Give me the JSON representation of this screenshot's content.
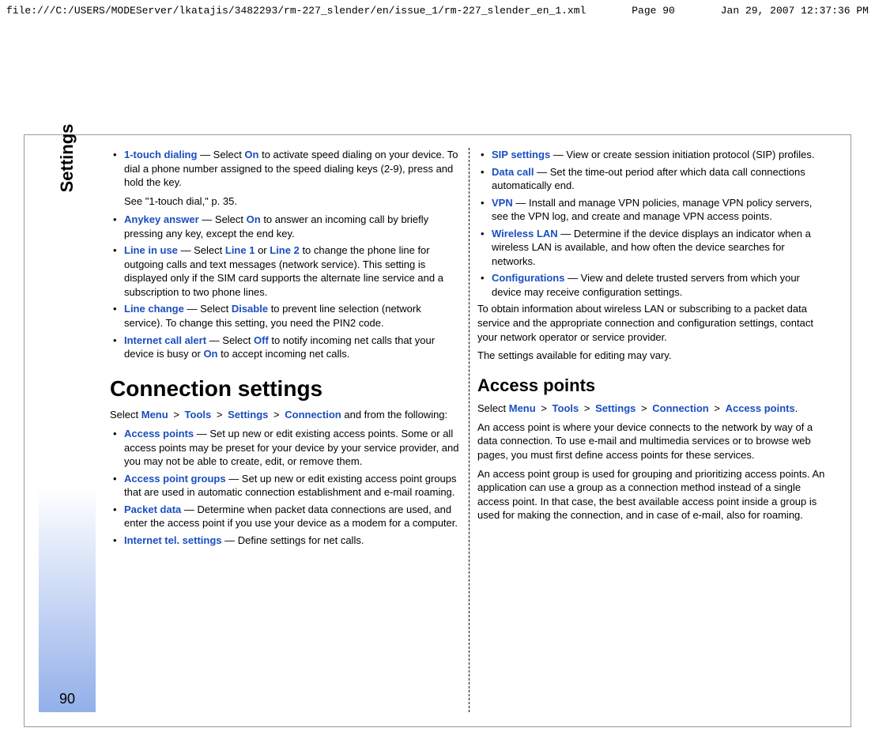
{
  "header": {
    "path": "file:///C:/USERS/MODEServer/lkatajis/3482293/rm-227_slender/en/issue_1/rm-227_slender_en_1.xml",
    "page_label": "Page 90",
    "timestamp": "Jan 29, 2007 12:37:36 PM"
  },
  "gutter": {
    "side_label": "Settings",
    "page_number": "90"
  },
  "left": {
    "items": [
      {
        "term": "1-touch dialing",
        "sep": " — Select ",
        "kw": "On",
        "rest": " to activate speed dialing on your device. To dial a phone number assigned to the speed dialing keys (2-9), press and hold the key.",
        "after": "See \"1-touch dial,\" p. 35."
      },
      {
        "term": "Anykey answer",
        "sep": " — Select ",
        "kw": "On",
        "rest": " to answer an incoming call by briefly pressing any key, except the end key."
      },
      {
        "term": "Line in use",
        "sep": " — Select ",
        "kw": "Line 1",
        "mid": " or ",
        "kw2": "Line 2",
        "rest": " to change the phone line for outgoing calls and text messages (network service). This setting is displayed only if the SIM card supports the alternate line service and a subscription to two phone lines."
      },
      {
        "term": "Line change",
        "sep": " — Select ",
        "kw": "Disable",
        "rest": " to prevent line selection (network service). To change this setting, you need the PIN2 code."
      },
      {
        "term": "Internet call alert",
        "sep": " — Select ",
        "kw": "Off",
        "mid": " to notify incoming net calls that your device is busy or ",
        "kw2": "On",
        "rest": " to accept incoming net calls."
      }
    ],
    "heading": "Connection settings",
    "nav": {
      "prefix": "Select ",
      "parts": [
        "Menu",
        "Tools",
        "Settings",
        "Connection"
      ],
      "suffix": " and from the following:"
    },
    "items2": [
      {
        "term": "Access points",
        "rest": " — Set up new or edit existing access points. Some or all access points may be preset for your device by your service provider, and you may not be able to create, edit, or remove them."
      },
      {
        "term": "Access point groups",
        "rest": " — Set up new or edit existing access point groups that are used in automatic connection establishment and e-mail roaming."
      },
      {
        "term": "Packet data",
        "rest": " — Determine when packet data connections are used, and enter the access point if you use your device as a modem for a computer."
      },
      {
        "term": "Internet tel. settings",
        "rest": " — Define settings for net calls."
      }
    ]
  },
  "right": {
    "items": [
      {
        "term": "SIP settings",
        "rest": " — View or create session initiation protocol (SIP) profiles."
      },
      {
        "term": "Data call",
        "rest": " — Set the time-out period after which data call connections automatically end."
      },
      {
        "term": "VPN",
        "rest": " — Install and manage VPN policies, manage VPN policy servers, see the VPN log, and create and manage VPN access points."
      },
      {
        "term": "Wireless LAN",
        "rest": " — Determine if the device displays an indicator when a wireless LAN is available, and how often the device searches for networks."
      },
      {
        "term": "Configurations",
        "rest": " — View and delete trusted servers from which your device may receive configuration settings."
      }
    ],
    "p1": "To obtain information about wireless LAN or subscribing to a packet data service and the appropriate connection and configuration settings, contact your network operator or service provider.",
    "p2": "The settings available for editing may vary.",
    "heading": "Access points",
    "nav2": {
      "prefix": "Select ",
      "parts": [
        "Menu",
        "Tools",
        "Settings",
        "Connection",
        "Access points"
      ],
      "suffix": "."
    },
    "p3": "An access point is where your device connects to the network by way of a data connection. To use e-mail and multimedia services or to browse web pages, you must first define access points for these services.",
    "p4": "An access point group is used for grouping and prioritizing access points. An application can use a group as a connection method instead of a single access point. In that case, the best available access point inside a group is used for making the connection, and in case of e-mail, also for roaming."
  },
  "glyphs": {
    "sep": ">"
  }
}
